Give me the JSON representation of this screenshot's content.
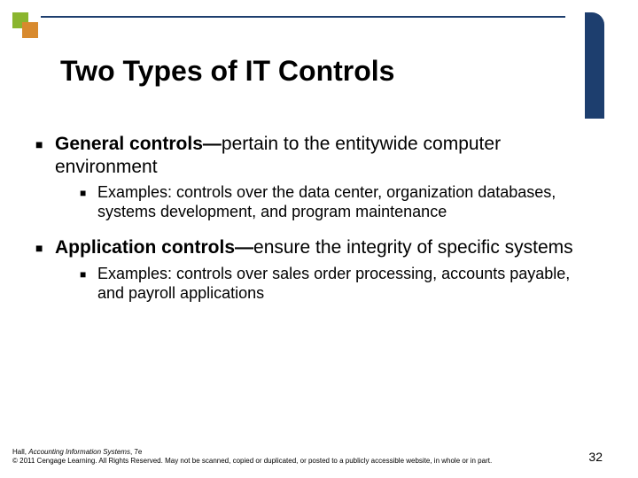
{
  "title": "Two Types of IT Controls",
  "bullets": [
    {
      "lead": "General controls—",
      "rest": "pertain to the entitywide computer environment",
      "sub": "Examples: controls over the data center, organization databases, systems development, and program maintenance"
    },
    {
      "lead": "Application controls—",
      "rest": "ensure the integrity of specific systems",
      "sub": "Examples: controls over sales order processing, accounts payable, and payroll applications"
    }
  ],
  "footer": {
    "author": "Hall, ",
    "book": "Accounting Information Systems",
    "edition": ", 7e",
    "copyright": "© 2011 Cengage Learning. All Rights Reserved. May not be scanned, copied or duplicated, or posted to a publicly accessible website, in whole or in part."
  },
  "page": "32"
}
